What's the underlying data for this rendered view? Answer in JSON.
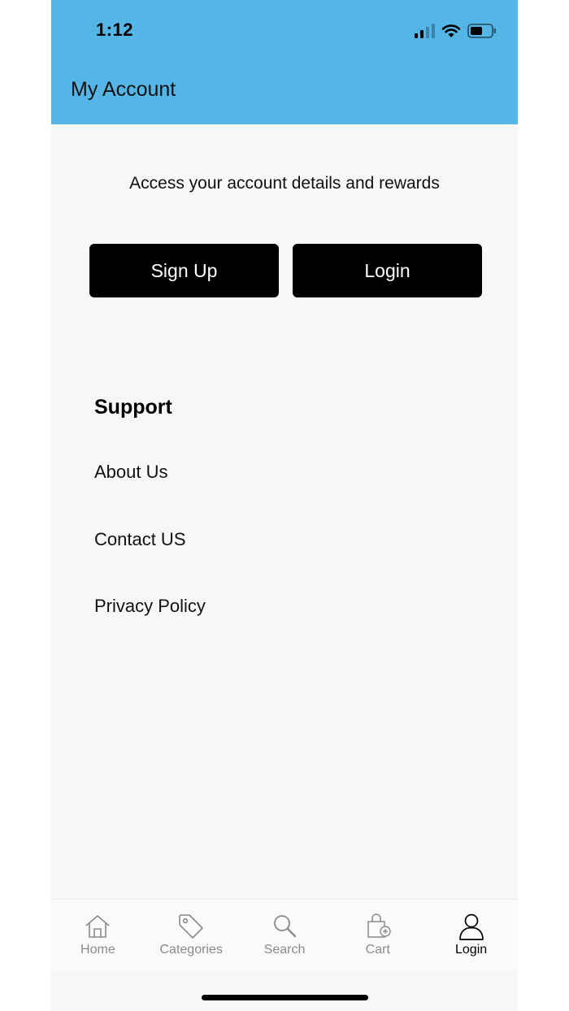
{
  "status_bar": {
    "time": "1:12"
  },
  "header": {
    "title": "My Account"
  },
  "intro": {
    "text": "Access your account details and rewards"
  },
  "buttons": {
    "sign_up": "Sign Up",
    "login": "Login"
  },
  "support": {
    "heading": "Support",
    "links": [
      "About Us",
      "Contact US",
      "Privacy Policy"
    ]
  },
  "tabbar": {
    "tabs": [
      {
        "label": "Home",
        "icon": "home-icon",
        "active": false
      },
      {
        "label": "Categories",
        "icon": "tag-icon",
        "active": false
      },
      {
        "label": "Search",
        "icon": "search-icon",
        "active": false
      },
      {
        "label": "Cart",
        "icon": "shopping-bag-icon",
        "active": false
      },
      {
        "label": "Login",
        "icon": "user-icon",
        "active": true
      }
    ]
  },
  "colors": {
    "header_bg": "#54b6e6",
    "button_bg": "#000000",
    "page_bg": "#f7f7f7"
  }
}
